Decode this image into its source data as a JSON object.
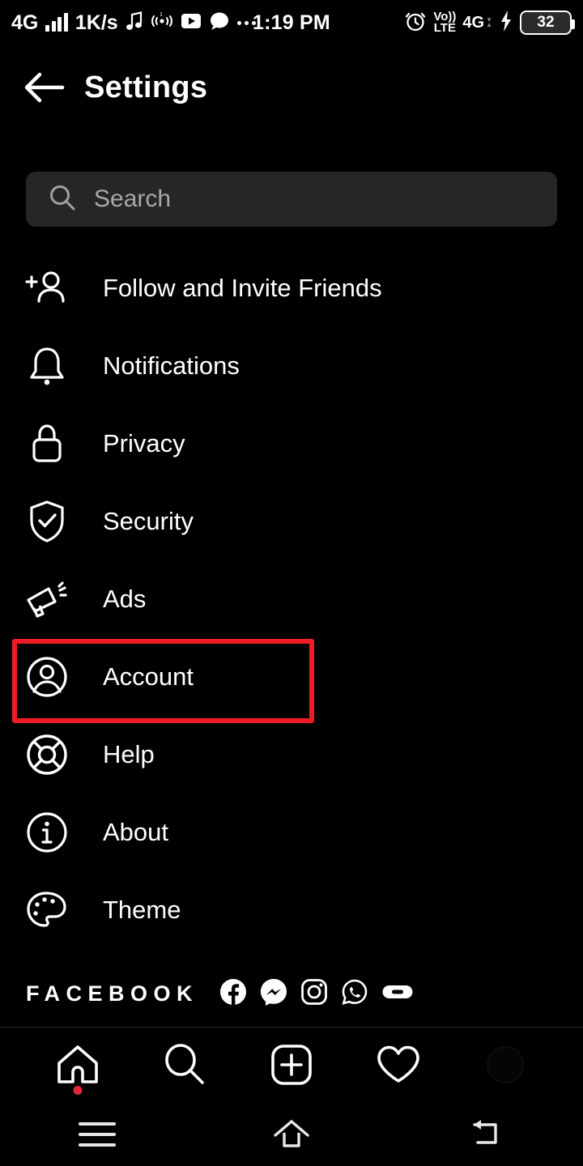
{
  "status_bar": {
    "network_label": "4G",
    "data_rate": "1K/s",
    "time": "1:19 PM",
    "volte_line1": "Vo))",
    "volte_line2": "LTE",
    "network_right": "4G",
    "battery_percent": "32",
    "icons": [
      "signal-bars-icon",
      "music-note-icon",
      "vibrate-icon",
      "youtube-icon",
      "chat-bubble-icon",
      "more-dots-icon",
      "alarm-clock-icon",
      "charging-bolt-icon",
      "battery-icon"
    ]
  },
  "app_bar": {
    "back_icon": "back-arrow-icon",
    "title": "Settings"
  },
  "search": {
    "placeholder": "Search",
    "icon": "search-icon"
  },
  "menu": {
    "items": [
      {
        "label": "Follow and Invite Friends",
        "icon": "add-person-icon"
      },
      {
        "label": "Notifications",
        "icon": "bell-icon"
      },
      {
        "label": "Privacy",
        "icon": "lock-icon"
      },
      {
        "label": "Security",
        "icon": "shield-check-icon"
      },
      {
        "label": "Ads",
        "icon": "megaphone-icon"
      },
      {
        "label": "Account",
        "icon": "account-circle-icon",
        "highlighted": true
      },
      {
        "label": "Help",
        "icon": "lifebuoy-icon"
      },
      {
        "label": "About",
        "icon": "info-circle-icon"
      },
      {
        "label": "Theme",
        "icon": "palette-icon"
      }
    ],
    "highlight_color": "#ef1b26"
  },
  "facebook_section": {
    "label": "FACEBOOK",
    "icons": [
      "facebook-icon",
      "messenger-icon",
      "instagram-icon",
      "whatsapp-icon",
      "oculus-icon"
    ]
  },
  "bottom_nav": {
    "items": [
      {
        "icon": "home-icon",
        "badge": true
      },
      {
        "icon": "search-icon",
        "badge": false
      },
      {
        "icon": "add-post-icon",
        "badge": false
      },
      {
        "icon": "heart-icon",
        "badge": false
      },
      {
        "icon": "profile-avatar-icon",
        "badge": false
      }
    ],
    "badge_color": "#e2273c"
  },
  "system_nav": {
    "items": [
      {
        "icon": "recents-icon"
      },
      {
        "icon": "home-outline-icon"
      },
      {
        "icon": "back-icon"
      }
    ]
  }
}
